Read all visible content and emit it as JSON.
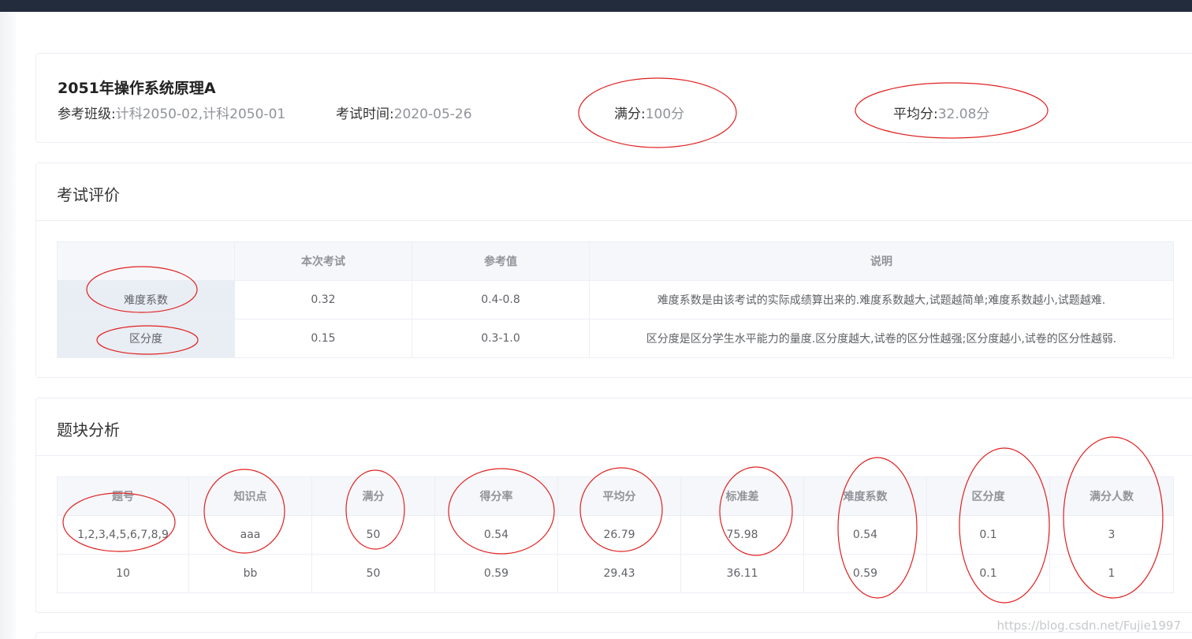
{
  "header": {
    "exam_title": "2051年操作系统原理A",
    "classes_label": "参考班级:",
    "classes_value": "计科2050-02,计科2050-01",
    "time_label": "考试时间:",
    "time_value": "2020-05-26",
    "full_label": "满分:",
    "full_value": "100分",
    "avg_label": "平均分:",
    "avg_value": "32.08分"
  },
  "evaluation": {
    "title": "考试评价",
    "columns": [
      "",
      "本次考试",
      "参考值",
      "说明"
    ],
    "rows": [
      {
        "name": "难度系数",
        "current": "0.32",
        "reference": "0.4-0.8",
        "desc": "难度系数是由该考试的实际成绩算出来的.难度系数越大,试题越简单;难度系数越小,试题越难."
      },
      {
        "name": "区分度",
        "current": "0.15",
        "reference": "0.3-1.0",
        "desc": "区分度是区分学生水平能力的量度.区分度越大,试卷的区分性越强;区分度越小,试卷的区分性越弱."
      }
    ]
  },
  "block_analysis": {
    "title": "题块分析",
    "columns": [
      "题号",
      "知识点",
      "满分",
      "得分率",
      "平均分",
      "标准差",
      "难度系数",
      "区分度",
      "满分人数"
    ],
    "rows": [
      [
        "1,2,3,4,5,6,7,8,9",
        "aaa",
        "50",
        "0.54",
        "26.79",
        "75.98",
        "0.54",
        "0.1",
        "3"
      ],
      [
        "10",
        "bb",
        "50",
        "0.59",
        "29.43",
        "36.11",
        "0.59",
        "0.1",
        "1"
      ]
    ]
  },
  "watermark": "https://blog.csdn.net/Fujie1997",
  "colors": {
    "topbar": "#232c3d",
    "annotation": "#e02020",
    "table_header_bg": "#f5f7fa",
    "row_header_bg": "#e9edf4",
    "muted_text": "#909399"
  }
}
